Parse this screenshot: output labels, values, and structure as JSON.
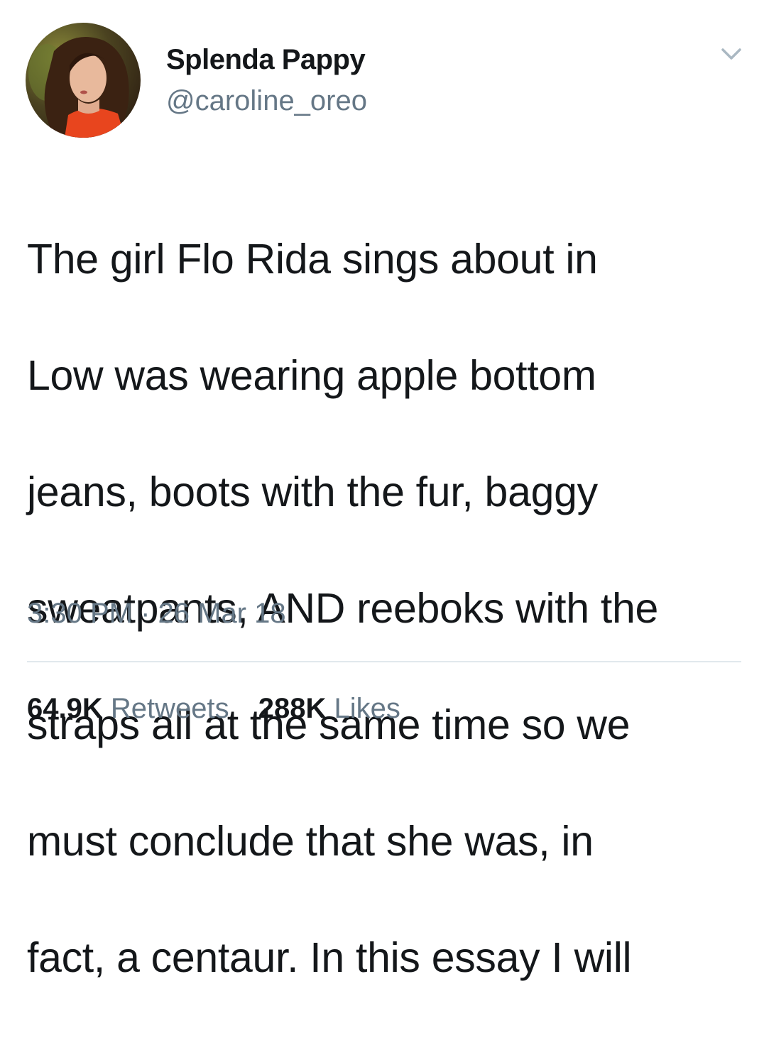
{
  "author": {
    "display_name": "Splenda Pappy",
    "handle": "@caroline_oreo",
    "avatar_icon": "profile-photo"
  },
  "menu_icon": "chevron-down-icon",
  "tweet": {
    "text_lines": [
      "The girl Flo Rida sings about in",
      "Low was wearing apple bottom",
      "jeans, boots with the fur, baggy",
      "sweatpants, AND reeboks with the",
      "straps all at the same time so we",
      "must conclude that she was, in",
      "fact, a centaur. In this essay I will"
    ],
    "timestamp": "3:30 PM · 26 Mar 18"
  },
  "stats": {
    "retweets_count": "64.9K",
    "retweets_label": "Retweets",
    "likes_count": "288K",
    "likes_label": "Likes"
  },
  "colors": {
    "text": "#14171a",
    "secondary": "#657786",
    "divider": "#e1e8ed"
  }
}
